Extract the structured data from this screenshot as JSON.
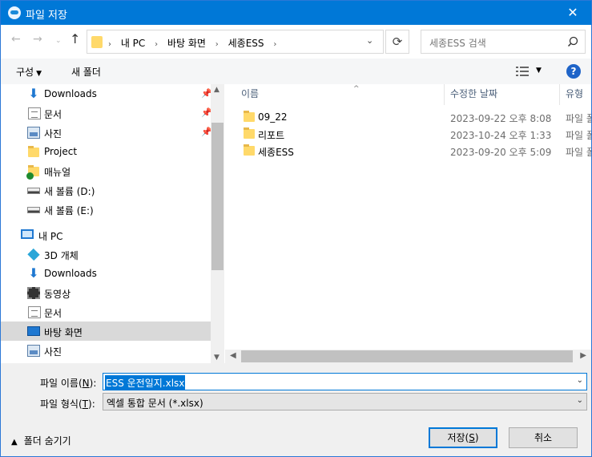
{
  "window": {
    "title": "파일 저장",
    "close_label": "✕"
  },
  "nav": {
    "back": "←",
    "forward": "→",
    "recent": "⌄",
    "up": "↑",
    "breadcrumbs": [
      "내 PC",
      "바탕 화면",
      "세종ESS"
    ],
    "crumb_sep": "›",
    "address_dropdown": "⌄",
    "refresh": "⟳",
    "search_placeholder": "세종ESS 검색"
  },
  "toolbar": {
    "organize": "구성",
    "organize_caret": "▼",
    "new_folder": "새 폴더",
    "view_caret": "▼",
    "help": "?"
  },
  "tree": {
    "items": [
      {
        "label": "Downloads",
        "icon": "download-icon",
        "pinned": true
      },
      {
        "label": "문서",
        "icon": "document-icon",
        "pinned": true
      },
      {
        "label": "사진",
        "icon": "picture-icon",
        "pinned": true
      },
      {
        "label": "Project",
        "icon": "folder-icon"
      },
      {
        "label": "매뉴얼",
        "icon": "folder-sync-icon"
      },
      {
        "label": "새 볼륨 (D:)",
        "icon": "drive-icon"
      },
      {
        "label": "새 볼륨 (E:)",
        "icon": "drive-icon"
      },
      {
        "label": "내 PC",
        "icon": "computer-icon"
      },
      {
        "label": "3D 개체",
        "icon": "3d-objects-icon"
      },
      {
        "label": "Downloads",
        "icon": "download-icon"
      },
      {
        "label": "동영상",
        "icon": "video-icon"
      },
      {
        "label": "문서",
        "icon": "document-icon"
      },
      {
        "label": "바탕 화면",
        "icon": "desktop-icon",
        "selected": true
      },
      {
        "label": "사진",
        "icon": "picture-icon"
      }
    ],
    "pin_glyph": "📌"
  },
  "files": {
    "columns": {
      "name": "이름",
      "date": "수정한 날짜",
      "type": "유형"
    },
    "sort_glyph": "^",
    "rows": [
      {
        "name": "09_22",
        "date": "2023-09-22 오후 8:08",
        "type": "파일 폴더"
      },
      {
        "name": "리포트",
        "date": "2023-10-24 오후 1:33",
        "type": "파일 폴더"
      },
      {
        "name": "세종ESS",
        "date": "2023-09-20 오후 5:09",
        "type": "파일 폴더"
      }
    ]
  },
  "scroll": {
    "up": "▲",
    "down": "▼",
    "left": "◀",
    "right": "▶"
  },
  "form": {
    "filename_label": "파일 이름",
    "filename_key": "N",
    "filename_value": "ESS 운전일지.xlsx",
    "filetype_label": "파일 형식",
    "filetype_key": "T",
    "filetype_value": "엑셀 통합 문서 (*.xlsx)",
    "combo_arrow": "⌄"
  },
  "footer": {
    "hide_folders": "폴더 숨기기",
    "hide_caret": "▲",
    "save_label": "저장",
    "save_key": "S",
    "cancel_label": "취소"
  },
  "colors": {
    "accent": "#0078d7",
    "selected_row": "#d9d9d9"
  }
}
